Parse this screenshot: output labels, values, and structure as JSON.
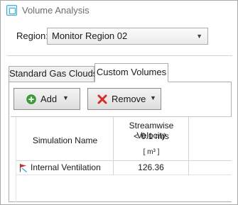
{
  "window": {
    "title": "Volume Analysis",
    "icon": "app-window-icon"
  },
  "region": {
    "label": "Region:",
    "selected": "Monitor Region 02"
  },
  "tabs": [
    {
      "label": "Standard Gas Clouds",
      "active": false
    },
    {
      "label": "Custom Volumes",
      "active": true
    }
  ],
  "toolbar": {
    "add_label": "Add",
    "remove_label": "Remove"
  },
  "table": {
    "columns": [
      {
        "label": "Simulation Name"
      },
      {
        "label_line1": "Streamwise Velocity",
        "label_line2": "< 0.1 m/s",
        "unit": "[ m³ ]"
      }
    ],
    "rows": [
      {
        "name": "Internal Ventilation",
        "value": "126.36",
        "icon": "simulation-flag-icon"
      }
    ]
  },
  "colors": {
    "add_green": "#3aa535",
    "remove_red": "#d42b2b",
    "icon_blue": "#3fa9d6"
  }
}
